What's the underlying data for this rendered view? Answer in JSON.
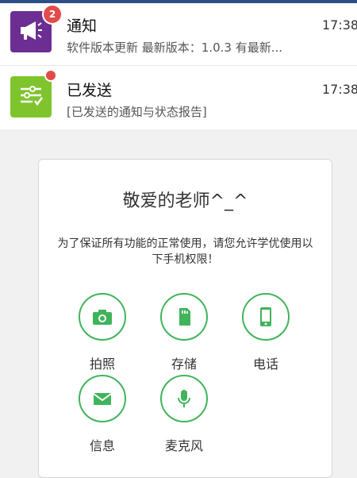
{
  "notifications": [
    {
      "title": "通知",
      "body": "软件版本更新 最新版本：1.0.3 有最新...",
      "time": "17:38",
      "badge": "2",
      "icon": "megaphone-icon",
      "icon_color": "#6c2e92"
    },
    {
      "title": "已发送",
      "body": "[已发送的通知与状态报告]",
      "time": "17:38",
      "icon": "sent-list-icon",
      "icon_color": "#7fc42d"
    }
  ],
  "dialog": {
    "title": "敬爱的老师^_^",
    "message": "为了保证所有功能的正常使用，请您允许学优使用以下手机权限！",
    "permissions": [
      {
        "label": "拍照",
        "icon": "camera-icon"
      },
      {
        "label": "存储",
        "icon": "storage-icon"
      },
      {
        "label": "电话",
        "icon": "phone-icon"
      },
      {
        "label": "信息",
        "icon": "message-icon"
      },
      {
        "label": "麦克风",
        "icon": "microphone-icon"
      }
    ]
  },
  "colors": {
    "accent_green": "#3fb45a",
    "badge_red": "#e24b4b",
    "status_bar": "#2d4f86"
  }
}
